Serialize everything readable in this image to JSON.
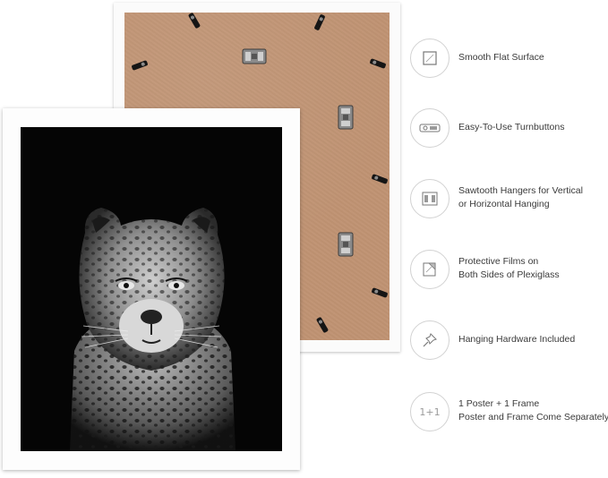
{
  "image": {
    "alt_subject": "Framed black and white leopard poster with backside view"
  },
  "colors": {
    "frame": "#fdfdfd",
    "backing": "#c09373",
    "poster_bg": "#050505",
    "text": "#3a3a3a",
    "icon_border": "#d2d2d2"
  },
  "features": [
    {
      "icon": "square-surface-icon",
      "lines": [
        "Smooth Flat Surface"
      ]
    },
    {
      "icon": "turnbutton-icon",
      "lines": [
        "Easy-To-Use Turnbuttons"
      ]
    },
    {
      "icon": "sawtooth-hanger-icon",
      "lines": [
        "Sawtooth Hangers for Vertical",
        "or Horizontal Hanging"
      ]
    },
    {
      "icon": "protective-film-icon",
      "lines": [
        "Protective Films on",
        "Both Sides of Plexiglass"
      ]
    },
    {
      "icon": "push-pin-icon",
      "lines": [
        "Hanging Hardware Included"
      ]
    },
    {
      "icon": "one-plus-one-icon",
      "icon_text": "1+1",
      "lines": [
        "1 Poster + 1 Frame",
        "Poster and Frame Come Separately"
      ]
    }
  ]
}
